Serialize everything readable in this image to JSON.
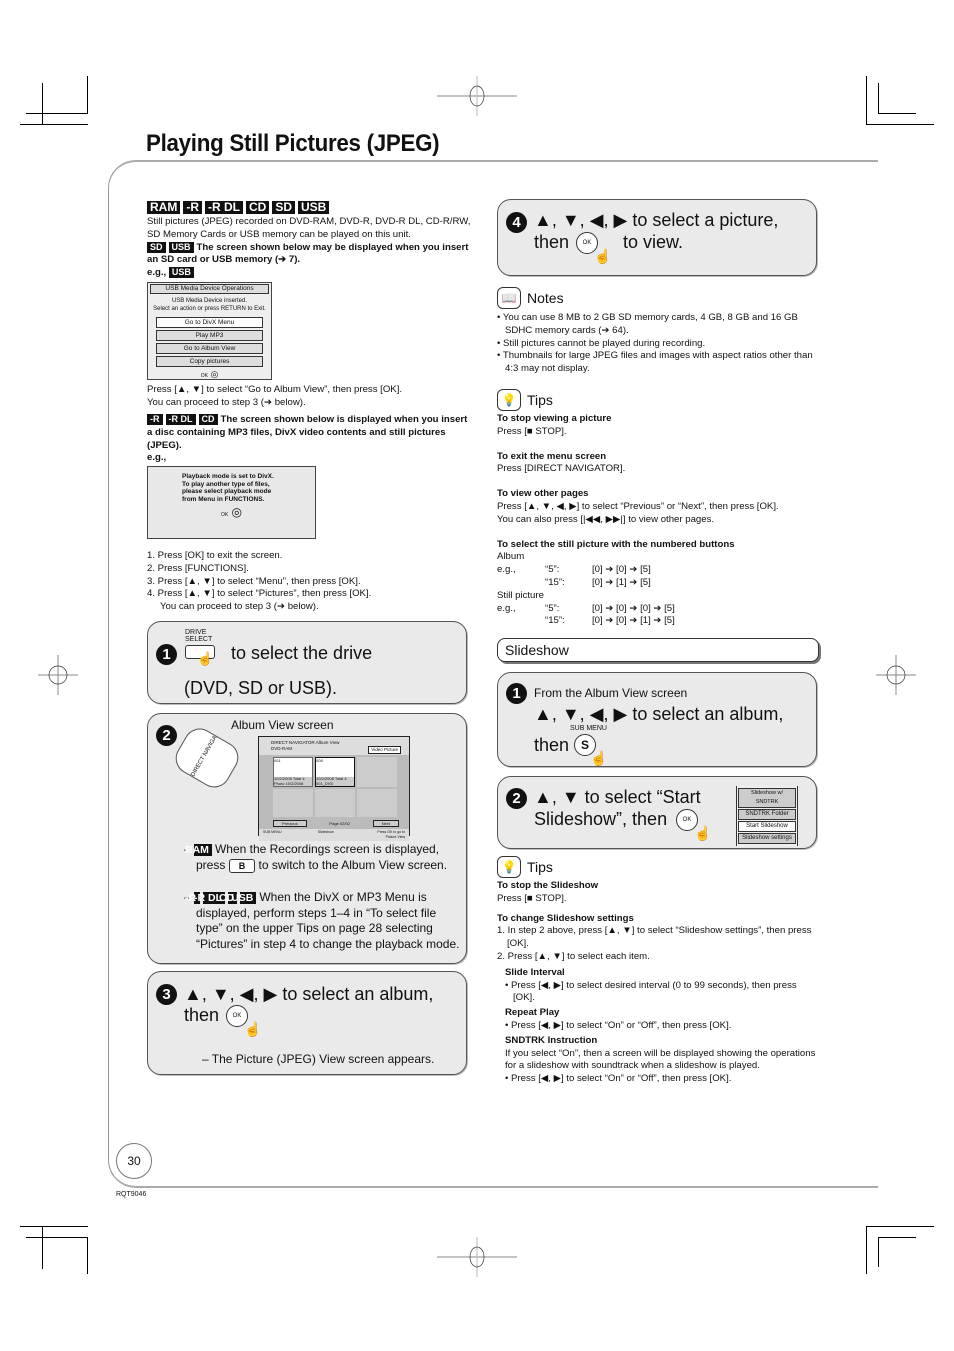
{
  "page": {
    "title": "Playing Still Pictures (JPEG)",
    "page_number": "30",
    "doc_code": "RQT9046"
  },
  "intro": {
    "tags": [
      "RAM",
      "-R",
      "-R DL",
      "CD",
      "SD",
      "USB"
    ],
    "text": "Still pictures (JPEG) recorded on DVD-RAM, DVD-R, DVD-R DL, CD-R/RW, SD Memory Cards or USB memory can be played on this unit.",
    "sd_usb_tags": [
      "SD",
      "USB"
    ],
    "sd_usb_text": "The screen shown below may be displayed when you insert an SD card or USB memory (➔ 7).",
    "eg_label": "e.g.,",
    "eg_tag": "USB"
  },
  "usb_screen": {
    "title": "USB Media Device Operations",
    "message_1": "USB Media Device inserted.",
    "message_2": "Select an action or press RETURN to Exit.",
    "options": [
      "Go to DivX Menu",
      "Play MP3",
      "Go to Album View",
      "Copy pictures"
    ],
    "selected_index": 0,
    "ok_label": "OK"
  },
  "usb_instruction_1": "Press [▲, ▼] to select “Go to Album View”, then press [OK].",
  "usb_instruction_2": "You can proceed to step 3 (➔ below).",
  "disc": {
    "tags": [
      "-R",
      "-R DL",
      "CD"
    ],
    "text": "The screen shown below is displayed when you insert a disc containing MP3 files, DivX video contents and still pictures (JPEG).",
    "eg_label": "e.g.,"
  },
  "divx_screen": {
    "lines": [
      "Playback mode is set to DivX.",
      "To play another type of files,",
      "please select playback mode",
      "from Menu in FUNCTIONS."
    ],
    "ok_label": "OK"
  },
  "disc_steps": [
    "1.  Press [OK] to exit the screen.",
    "2.  Press [FUNCTIONS].",
    "3.  Press [▲, ▼] to select “Menu”, then press [OK].",
    "4.  Press [▲, ▼] to select “Pictures”, then press [OK].",
    "You can proceed to step 3 (➔ below)."
  ],
  "step1": {
    "number": "1",
    "button_label": "DRIVE SELECT",
    "text_a": "to select the drive",
    "text_b": "(DVD, SD or USB)."
  },
  "step2": {
    "number": "2",
    "button_label": "DIRECT NAVIGATOR",
    "screen_caption": "Album View screen",
    "album_screen": {
      "header_1": "DIRECT NAVIGATOR   Album View",
      "header_2": "DVD-RAM",
      "tab_video": "Video",
      "tab_picture": "Picture",
      "albums": [
        {
          "num": "001",
          "line1": "10/2/2008  Total 4",
          "line2": "Photo 10/2/2008"
        },
        {
          "num": "008",
          "line1": "10/2/2008  Total 4",
          "line2": "001_DVD"
        }
      ],
      "prev_label": "Previous",
      "page_label": "Page",
      "page_value": "02/02",
      "next_label": "Next",
      "footer_sub": "SUB MENU",
      "footer_slide": "Slideshow",
      "footer_hint": "Press OK to go to Picture View"
    },
    "note1_tag": "RAM",
    "note1_text_a": "When the Recordings screen is displayed, press",
    "note1_button": "B",
    "note1_text_b": "to switch to the Album View screen.",
    "note2_tags": [
      "-R",
      "-R DL",
      "CD",
      "USB"
    ],
    "note2_text": "When the DivX or MP3 Menu is displayed, perform steps 1–4 in “To select file type” on the upper Tips on page 28 selecting “Pictures” in step 4 to change the playback mode."
  },
  "step3": {
    "number": "3",
    "text_a": "▲, ▼, ◀, ▶ to select an album,",
    "text_b": "then",
    "ok_label": "OK",
    "result": "– The Picture (JPEG) View screen appears."
  },
  "step4": {
    "number": "4",
    "text_a": "▲, ▼, ◀, ▶ to select a picture,",
    "text_b": "then",
    "text_c": "to view.",
    "ok_label": "OK"
  },
  "notes": {
    "heading": "Notes",
    "items": [
      "You can use 8 MB to 2 GB SD memory cards, 4 GB, 8 GB and 16 GB SDHC memory cards (➔ 64).",
      "Still pictures cannot be played during recording.",
      "Thumbnails for large JPEG files and images with aspect ratios other than 4:3 may not display."
    ]
  },
  "tips1": {
    "heading": "Tips",
    "stop_title": "To stop viewing a picture",
    "stop_text": "Press [■ STOP].",
    "exit_title": "To exit the menu screen",
    "exit_text": "Press [DIRECT NAVIGATOR].",
    "pages_title": "To view other pages",
    "pages_text_1": "Press [▲, ▼, ◀, ▶] to select “Previous” or “Next”, then press [OK].",
    "pages_text_2": "You can also press [|◀◀, ▶▶|] to view other pages.",
    "numbered_title": "To select the still picture with the numbered buttons",
    "album_label": "Album",
    "album_rows": [
      {
        "eg": "e.g.,",
        "value": "“5”:",
        "keys": "[0] ➔ [0] ➔ [5]"
      },
      {
        "eg": "",
        "value": "“15”:",
        "keys": "[0] ➔ [1] ➔ [5]"
      }
    ],
    "still_label": "Still picture",
    "still_rows": [
      {
        "eg": "e.g.,",
        "value": "“5”:",
        "keys": "[0] ➔ [0] ➔ [0] ➔ [5]"
      },
      {
        "eg": "",
        "value": "“15”:",
        "keys": "[0] ➔ [0] ➔ [1] ➔ [5]"
      }
    ]
  },
  "slideshow": {
    "heading": "Slideshow",
    "step1": {
      "number": "1",
      "pre": "From the Album View screen",
      "text_a": "▲, ▼, ◀, ▶ to select an album,",
      "text_b": "then",
      "button_caption": "SUB MENU",
      "button_label": "S"
    },
    "step2": {
      "number": "2",
      "text_a": "▲, ▼ to select “Start",
      "text_b": "Slideshow”, then",
      "ok_label": "OK",
      "menu": [
        "Slideshow w/ SNDTRK",
        "SNDTRK Folder",
        "Start Slideshow",
        "Slideshow settings"
      ],
      "selected_index": 2
    }
  },
  "tips2": {
    "heading": "Tips",
    "stop_title": "To stop the Slideshow",
    "stop_text": "Press [■ STOP].",
    "change_title": "To change Slideshow settings",
    "change_steps": [
      "1. In step 2 above, press [▲, ▼] to select “Slideshow settings”, then press [OK].",
      "2. Press [▲, ▼] to select each item."
    ],
    "interval_title": "Slide Interval",
    "interval_text": "• Press [◀, ▶] to select desired interval (0 to 99 seconds), then press [OK].",
    "repeat_title": "Repeat Play",
    "repeat_text": "• Press [◀, ▶] to select “On” or “Off”, then press [OK].",
    "sndtrk_title": "SNDTRK Instruction",
    "sndtrk_text": "If you select “On”, then a screen will be displayed showing the operations for a slideshow with soundtrack when a slideshow is played.",
    "sndtrk_bullet": "• Press [◀, ▶] to select “On” or “Off”, then press [OK]."
  }
}
